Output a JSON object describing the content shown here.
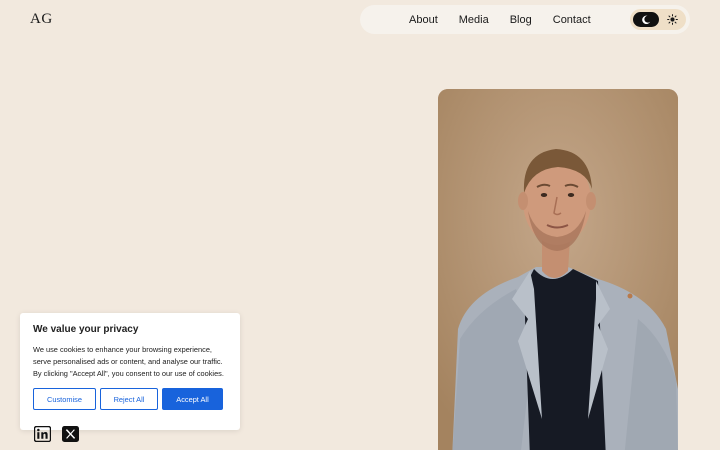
{
  "header": {
    "logo": "AG",
    "nav": [
      {
        "label": "About"
      },
      {
        "label": "Media"
      },
      {
        "label": "Blog"
      },
      {
        "label": "Contact"
      }
    ],
    "theme_toggle": {
      "dark_icon": "moon-icon",
      "light_icon": "sun-icon",
      "active": "dark"
    }
  },
  "hero": {
    "photo": "portrait-photo"
  },
  "cookie_banner": {
    "title": "We value your privacy",
    "text": "We use cookies to enhance your browsing experience, serve personalised ads or content, and analyse our traffic. By clicking \"Accept All\", you consent to our use of cookies.",
    "buttons": {
      "customise": "Customise",
      "reject": "Reject All",
      "accept": "Accept All"
    },
    "accent_color": "#1863dc"
  },
  "social": [
    {
      "icon": "linkedin-icon"
    },
    {
      "icon": "x-icon"
    }
  ],
  "colors": {
    "background": "#f2e9de",
    "nav_background": "#f6f2ec",
    "toggle_background": "#efdfc7"
  }
}
